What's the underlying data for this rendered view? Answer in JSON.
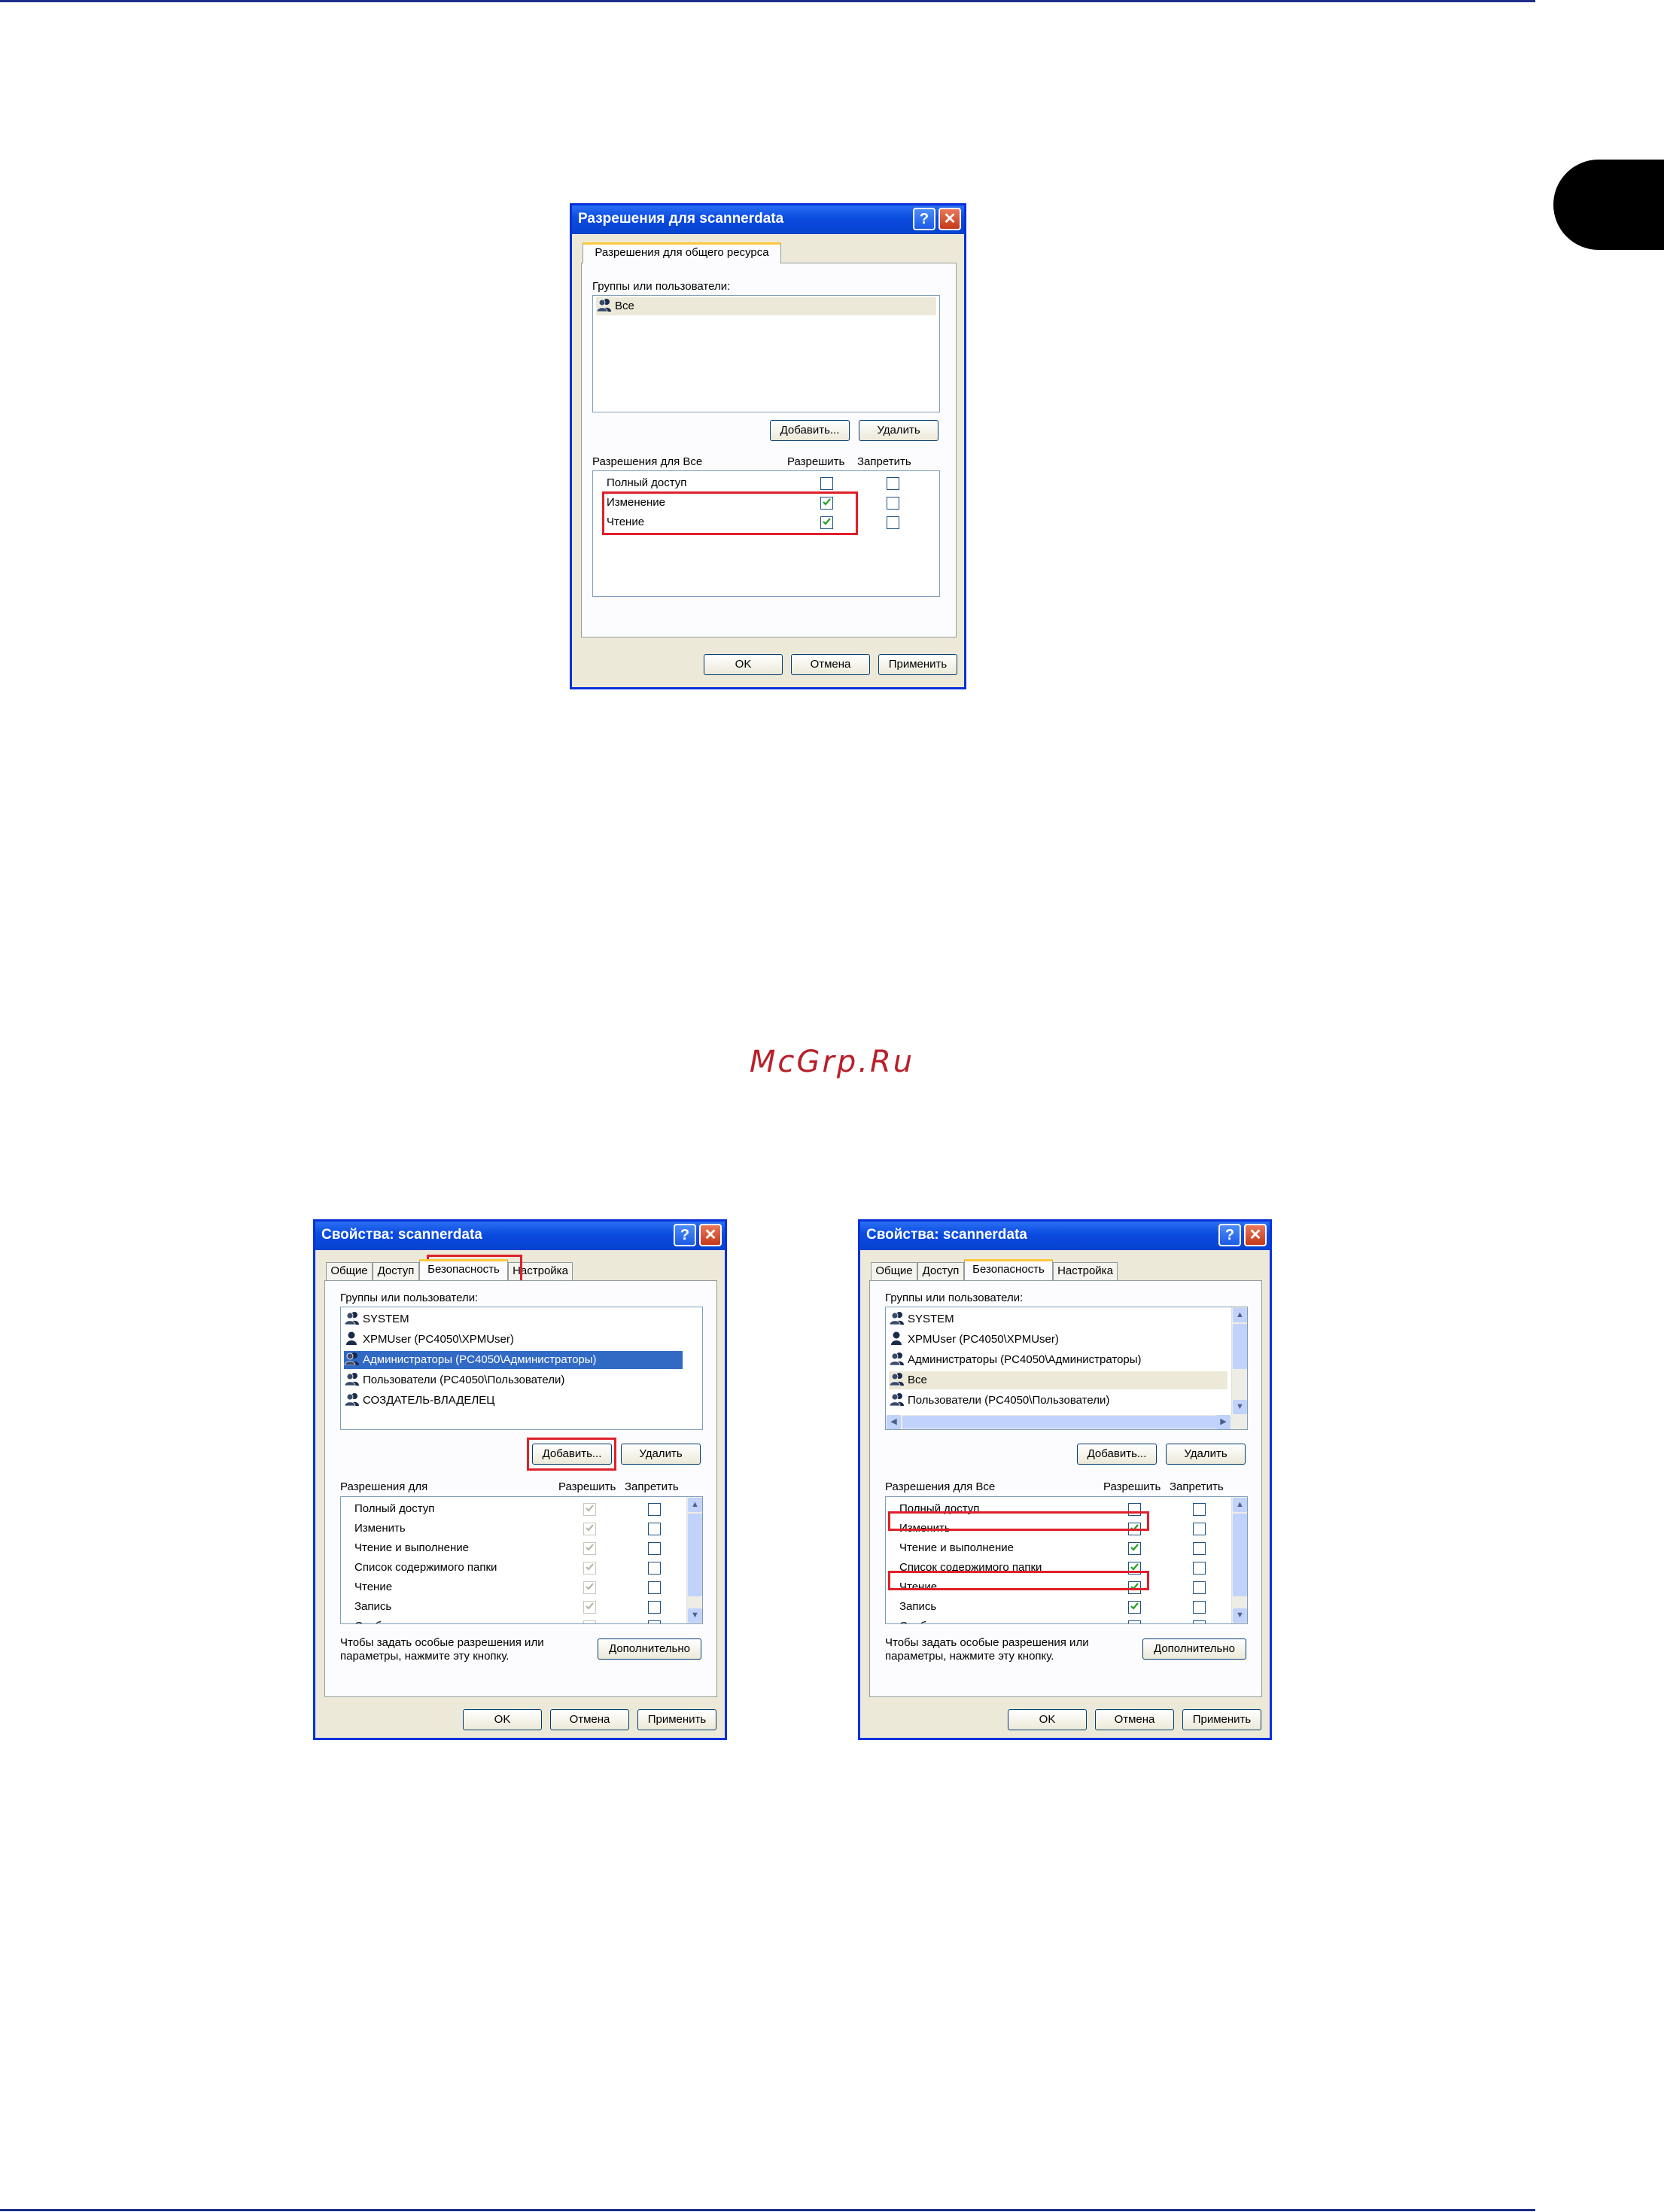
{
  "watermark": "McGrp.Ru",
  "dialog1": {
    "title": "Разрешения для scannerdata",
    "tab": "Разрешения для общего ресурса",
    "groups_label": "Группы или пользователи:",
    "users": [
      "Все"
    ],
    "add_button": "Добавить...",
    "remove_button": "Удалить",
    "perm_label": "Разрешения для Все",
    "allow_header": "Разрешить",
    "deny_header": "Запретить",
    "permissions": [
      {
        "name": "Полный доступ",
        "allow": false,
        "deny": false
      },
      {
        "name": "Изменение",
        "allow": true,
        "deny": false
      },
      {
        "name": "Чтение",
        "allow": true,
        "deny": false
      }
    ],
    "ok": "OK",
    "cancel": "Отмена",
    "apply": "Применить"
  },
  "dialog2": {
    "title": "Свойства: scannerdata",
    "tabs": [
      "Общие",
      "Доступ",
      "Безопасность",
      "Настройка"
    ],
    "groups_label": "Группы или пользователи:",
    "users": [
      "SYSTEM",
      "XPMUser (PC4050\\XPMUser)",
      "Администраторы (PC4050\\Администраторы)",
      "Пользователи (PC4050\\Пользователи)",
      "СОЗДАТЕЛЬ-ВЛАДЕЛЕЦ"
    ],
    "add_button": "Добавить...",
    "remove_button": "Удалить",
    "perm_label": "Разрешения для",
    "allow_header": "Разрешить",
    "deny_header": "Запретить",
    "permissions": [
      {
        "name": "Полный доступ",
        "allow": true,
        "deny": false
      },
      {
        "name": "Изменить",
        "allow": true,
        "deny": false
      },
      {
        "name": "Чтение и выполнение",
        "allow": true,
        "deny": false
      },
      {
        "name": "Список содержимого папки",
        "allow": true,
        "deny": false
      },
      {
        "name": "Чтение",
        "allow": true,
        "deny": false
      },
      {
        "name": "Запись",
        "allow": true,
        "deny": false
      },
      {
        "name": "Особые разрешения",
        "allow": false,
        "deny": false
      }
    ],
    "advanced_text_1": "Чтобы задать особые разрешения или",
    "advanced_text_2": "параметры, нажмите эту кнопку.",
    "advanced_button": "Дополнительно",
    "ok": "OK",
    "cancel": "Отмена",
    "apply": "Применить"
  },
  "dialog3": {
    "title": "Свойства: scannerdata",
    "tabs": [
      "Общие",
      "Доступ",
      "Безопасность",
      "Настройка"
    ],
    "groups_label": "Группы или пользователи:",
    "users": [
      "SYSTEM",
      "XPMUser (PC4050\\XPMUser)",
      "Администраторы (PC4050\\Администраторы)",
      "Все",
      "Пользователи (PC4050\\Пользователи)"
    ],
    "add_button": "Добавить...",
    "remove_button": "Удалить",
    "perm_label": "Разрешения для Все",
    "allow_header": "Разрешить",
    "deny_header": "Запретить",
    "permissions": [
      {
        "name": "Полный доступ",
        "allow": false,
        "deny": false
      },
      {
        "name": "Изменить",
        "allow": true,
        "deny": false
      },
      {
        "name": "Чтение и выполнение",
        "allow": true,
        "deny": false
      },
      {
        "name": "Список содержимого папки",
        "allow": true,
        "deny": false
      },
      {
        "name": "Чтение",
        "allow": true,
        "deny": false
      },
      {
        "name": "Запись",
        "allow": true,
        "deny": false
      },
      {
        "name": "Особые разрешения",
        "allow": false,
        "deny": false
      }
    ],
    "advanced_text_1": "Чтобы задать особые разрешения или",
    "advanced_text_2": "параметры, нажмите эту кнопку.",
    "advanced_button": "Дополнительно",
    "ok": "OK",
    "cancel": "Отмена",
    "apply": "Применить"
  }
}
